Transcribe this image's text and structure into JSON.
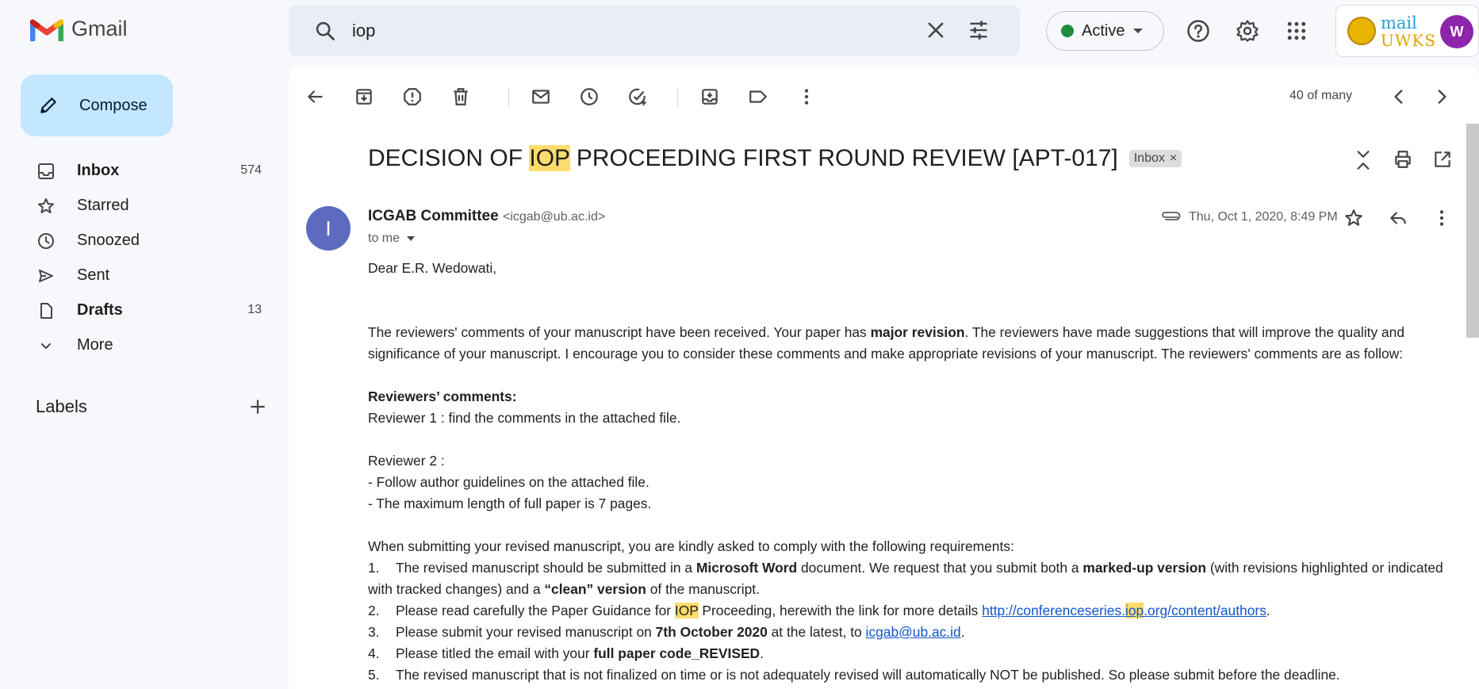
{
  "app": {
    "name": "Gmail"
  },
  "search": {
    "value": "iop"
  },
  "status": {
    "label": "Active"
  },
  "brand": {
    "line1": "mail",
    "line2": "UWKS"
  },
  "account": {
    "initial": "W"
  },
  "sidebar": {
    "compose": "Compose",
    "items": [
      {
        "label": "Inbox",
        "count": "574",
        "icon": "inbox-icon",
        "bold": true
      },
      {
        "label": "Starred",
        "count": "",
        "icon": "star-icon",
        "bold": false
      },
      {
        "label": "Snoozed",
        "count": "",
        "icon": "clock-icon",
        "bold": false
      },
      {
        "label": "Sent",
        "count": "",
        "icon": "send-icon",
        "bold": false
      },
      {
        "label": "Drafts",
        "count": "13",
        "icon": "draft-icon",
        "bold": true
      },
      {
        "label": "More",
        "count": "",
        "icon": "chevron-down-icon",
        "bold": false
      }
    ],
    "labels_title": "Labels"
  },
  "toolbar": {
    "paging": "40 of many"
  },
  "email": {
    "subject_pre": "DECISION OF ",
    "subject_hl": "IOP",
    "subject_post": " PROCEEDING FIRST ROUND REVIEW [APT-017]",
    "label_chip": "Inbox",
    "sender_initial": "I",
    "sender_name": "ICGAB Committee",
    "sender_addr": "<icgab@ub.ac.id>",
    "to": "to me",
    "date": "Thu, Oct 1, 2020, 8:49 PM",
    "greeting": "Dear E.R. Wedowati,",
    "p1_a": "The reviewers' comments of your manuscript have been received. Your paper has ",
    "p1_b": "major revision",
    "p1_c": ". The reviewers have made suggestions that will improve the quality and significance of your manuscript. I encourage you to consider these comments and make appropriate revisions of your manuscript. The reviewers' comments are as follow:",
    "rc_title": "Reviewers’ comments:",
    "r1": "Reviewer 1 : find the comments in the attached file.",
    "r2": "Reviewer 2 :",
    "r2_a": "- Follow author guidelines on the attached file.",
    "r2_b": "- The maximum length of full paper is 7 pages.",
    "req_intro": "When submitting your revised manuscript, you are kindly asked to comply with the following requirements:",
    "req1_n": "1.",
    "req1_a": "The revised manuscript should be submitted in a ",
    "req1_b": "Microsoft Word",
    "req1_c": " document. We request that you submit both a ",
    "req1_d": "marked-up version",
    "req1_e": " (with revisions highlighted or indicated with tracked changes) and a ",
    "req1_f": "“clean” version",
    "req1_g": " of the manuscript.",
    "req2_n": "2.",
    "req2_a": "Please read carefully the Paper Guidance for ",
    "req2_hl": "IOP",
    "req2_b": " Proceeding, herewith the link for more details ",
    "req2_link_a": "http://conferenceseries.",
    "req2_link_hl": "iop",
    "req2_link_b": ".org/content/authors",
    "req2_end": ".",
    "req3_n": "3.",
    "req3_a": "Please submit your revised manuscript on ",
    "req3_b": "7th October 2020",
    "req3_c": " at the latest, to ",
    "req3_link": "icgab@ub.ac.id",
    "req3_end": ".",
    "req4_n": "4.",
    "req4_a": "Please titled the email with your ",
    "req4_b": "full paper code_REVISED",
    "req4_end": ".",
    "req5_n": "5.",
    "req5_a": "The revised manuscript that is not finalized on time or is not adequately revised will automatically NOT be published. So please submit before the deadline."
  }
}
